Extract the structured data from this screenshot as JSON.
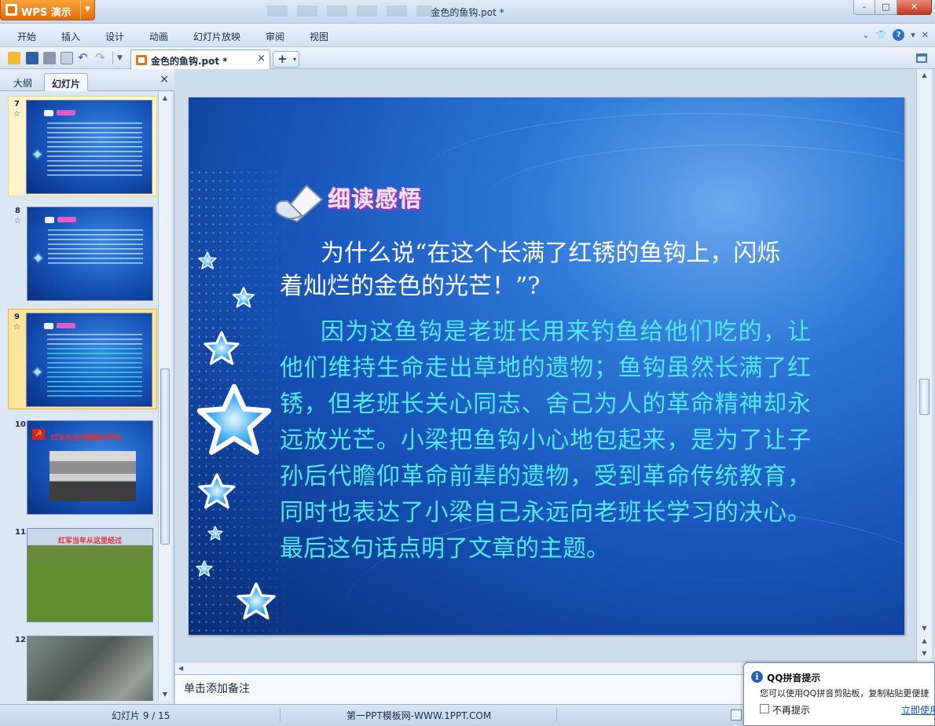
{
  "app": {
    "name": "WPS 演示",
    "window_title": "金色的鱼钩.pot *"
  },
  "menu": [
    "开始",
    "插入",
    "设计",
    "动画",
    "幻灯片放映",
    "审阅",
    "视图"
  ],
  "document_tab": {
    "label": "金色的鱼钩.pot *",
    "close": "×",
    "new_tab": "+"
  },
  "left_panel": {
    "tabs": [
      "大纲",
      "幻灯片"
    ],
    "active_tab": "幻灯片",
    "close": "×",
    "slides": [
      {
        "num": "7",
        "star": "☆"
      },
      {
        "num": "8",
        "star": "☆"
      },
      {
        "num": "9",
        "star": "☆"
      },
      {
        "num": "10",
        "title": "红军长征中翻越的草地"
      },
      {
        "num": "11",
        "title": "红军当年从这里经过"
      },
      {
        "num": "12"
      }
    ]
  },
  "slide": {
    "title": "细读感悟",
    "question": "为什么说“在这个长满了红锈的鱼钩上，闪烁着灿烂的金色的光芒！”?",
    "answer": "因为这鱼钩是老班长用来钓鱼给他们吃的，让他们维持生命走出草地的遗物；鱼钩虽然长满了红锈，但老班长关心同志、舍己为人的革命精神却永远放光芒。小梁把鱼钩小心地包起来，是为了让子孙后代瞻仰革命前辈的遗物，受到革命传统教育，同时也表达了小梁自己永远向老班长学习的决心。最后这句话点明了文章的主题。"
  },
  "notes": {
    "placeholder": "单击添加备注"
  },
  "status": {
    "slide_indicator": "幻灯片 9 / 15",
    "template": "第一PPT模板网-WWW.1PPT.COM"
  },
  "qq_popup": {
    "title": "QQ拼音提示",
    "body": "您可以使用QQ拼音剪贴板，复制粘贴更便捷",
    "checkbox_label": "不再提示",
    "link": "立即使用"
  },
  "colors": {
    "slide_question": "#ffffff",
    "slide_answer": "#52e8ef",
    "app_button": "#e8720f"
  }
}
